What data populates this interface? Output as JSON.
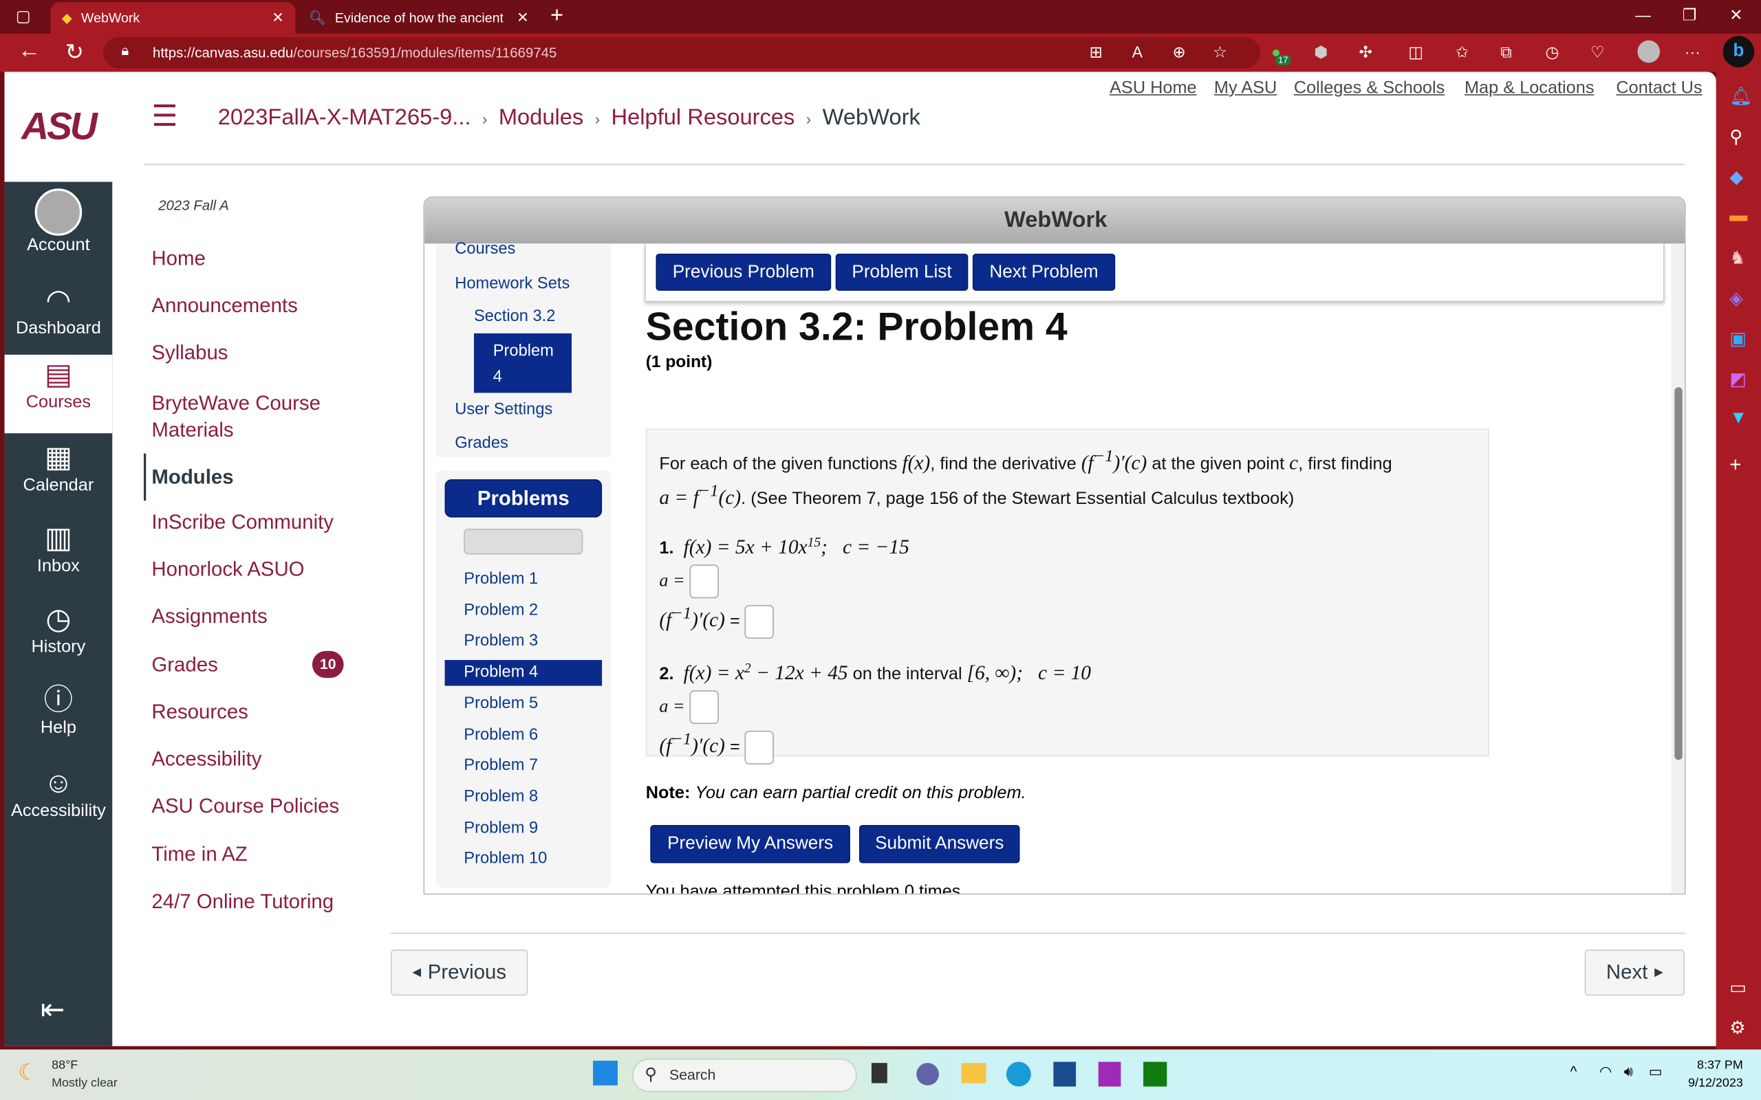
{
  "browser": {
    "tabs": [
      {
        "title": "WebWork",
        "active": true
      },
      {
        "title": "Evidence of how the ancients des",
        "active": false
      }
    ],
    "url_host": "https://canvas.asu.edu",
    "url_path": "/courses/163591/modules/items/11669745",
    "extension_badge": "17"
  },
  "global_nav": {
    "logo": "ASU",
    "items": [
      {
        "label": "Account",
        "icon": "avatar-icon"
      },
      {
        "label": "Dashboard",
        "icon": "gauge-icon"
      },
      {
        "label": "Courses",
        "icon": "book-icon",
        "active": true
      },
      {
        "label": "Calendar",
        "icon": "calendar-icon"
      },
      {
        "label": "Inbox",
        "icon": "inbox-icon"
      },
      {
        "label": "History",
        "icon": "clock-icon"
      },
      {
        "label": "Help",
        "icon": "question-icon"
      },
      {
        "label": "Accessibility",
        "icon": "accessibility-icon"
      }
    ]
  },
  "header": {
    "breadcrumb": [
      "2023FallA-X-MAT265-9...",
      "Modules",
      "Helpful Resources",
      "WebWork"
    ],
    "top_links": [
      "ASU Home",
      "My ASU",
      "Colleges & Schools",
      "Map & Locations",
      "Contact Us"
    ]
  },
  "course_nav": {
    "term": "2023 Fall A",
    "items": [
      "Home",
      "Announcements",
      "Syllabus",
      "BryteWave Course Materials",
      "Modules",
      "InScribe Community",
      "Honorlock ASUO",
      "Assignments",
      "Grades",
      "Resources",
      "Accessibility",
      "ASU Course Policies",
      "Time in AZ",
      "24/7 Online Tutoring"
    ],
    "active": "Modules",
    "grades_badge": "10"
  },
  "webwork": {
    "title": "WebWork",
    "side_links": {
      "courses": "Courses",
      "homework_sets": "Homework Sets",
      "section": "Section 3.2",
      "problem": "Problem 4",
      "user_settings": "User Settings",
      "grades": "Grades"
    },
    "problems_header": "Problems",
    "problems": [
      "Problem 1",
      "Problem 2",
      "Problem 3",
      "Problem 4",
      "Problem 5",
      "Problem 6",
      "Problem 7",
      "Problem 8",
      "Problem 9",
      "Problem 10"
    ],
    "active_problem": "Problem 4",
    "buttons": {
      "prev": "Previous Problem",
      "list": "Problem List",
      "next": "Next Problem",
      "preview": "Preview My Answers",
      "submit": "Submit Answers"
    },
    "problem_title": "Section 3.2: Problem 4",
    "points": "(1 point)",
    "intro_1": "For each of the given functions",
    "intro_2": ", find the derivative",
    "intro_3": "at the given point",
    "intro_4": ", first finding",
    "intro_5": ". (See Theorem 7, page 156 of the Stewart Essential Calculus textbook)",
    "parts": [
      {
        "num": "1.",
        "func": "f(x) = 5x + 10x",
        "exp": "15",
        "rest": ";   c = −15",
        "extra": ""
      },
      {
        "num": "2.",
        "func": "f(x) = x",
        "exp": "2",
        "rest": " − 12x + 45",
        "extra": " on the interval ",
        "interval": "[6, ∞);   c = 10"
      }
    ],
    "a_label": "a =",
    "deriv_label": "=",
    "note_label": "Note:",
    "note_text": "You can earn partial credit on this problem.",
    "attempts": "You have attempted this problem 0 times."
  },
  "pager": {
    "previous": "Previous",
    "next": "Next"
  },
  "taskbar": {
    "temp": "88°F",
    "weather": "Mostly clear",
    "search": "Search",
    "time": "8:37 PM",
    "date": "9/12/2023"
  }
}
